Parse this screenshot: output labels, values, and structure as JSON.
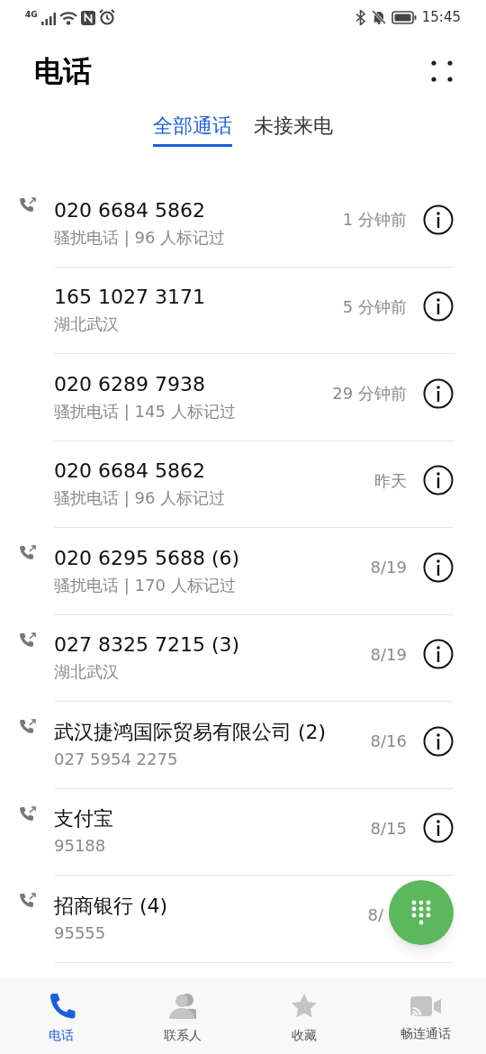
{
  "status_bar": {
    "network": "4G",
    "time": "15:45"
  },
  "title": "电话",
  "tabs": [
    {
      "label": "全部通话",
      "selected": true
    },
    {
      "label": "未接来电",
      "selected": false
    }
  ],
  "calls": [
    {
      "name": "020 6684 5862",
      "detail": "骚扰电话 | 96 人标记过",
      "time": "1 分钟前",
      "outgoing": true,
      "info": true
    },
    {
      "name": "165 1027 3171",
      "detail": "湖北武汉",
      "time": "5 分钟前",
      "outgoing": false,
      "info": true
    },
    {
      "name": "020 6289 7938",
      "detail": "骚扰电话 | 145 人标记过",
      "time": "29 分钟前",
      "outgoing": false,
      "info": true
    },
    {
      "name": "020 6684 5862",
      "detail": "骚扰电话 | 96 人标记过",
      "time": "昨天",
      "outgoing": false,
      "info": true
    },
    {
      "name": "020 6295 5688 (6)",
      "detail": "骚扰电话 | 170 人标记过",
      "time": "8/19",
      "outgoing": true,
      "info": true
    },
    {
      "name": "027 8325 7215 (3)",
      "detail": "湖北武汉",
      "time": "8/19",
      "outgoing": true,
      "info": true
    },
    {
      "name": "武汉捷鸿国际贸易有限公司 (2)",
      "detail": "027 5954 2275",
      "time": "8/16",
      "outgoing": true,
      "info": true
    },
    {
      "name": "支付宝",
      "detail": "95188",
      "time": "8/15",
      "outgoing": true,
      "info": true
    },
    {
      "name": "招商银行 (4)",
      "detail": "95555",
      "time": "8/",
      "outgoing": true,
      "info": false
    }
  ],
  "nav": [
    {
      "kind": "phone",
      "label": "电话",
      "selected": true
    },
    {
      "kind": "contacts",
      "label": "联系人",
      "selected": false
    },
    {
      "kind": "star",
      "label": "收藏",
      "selected": false
    },
    {
      "kind": "video",
      "label": "畅连通话",
      "selected": false
    }
  ]
}
